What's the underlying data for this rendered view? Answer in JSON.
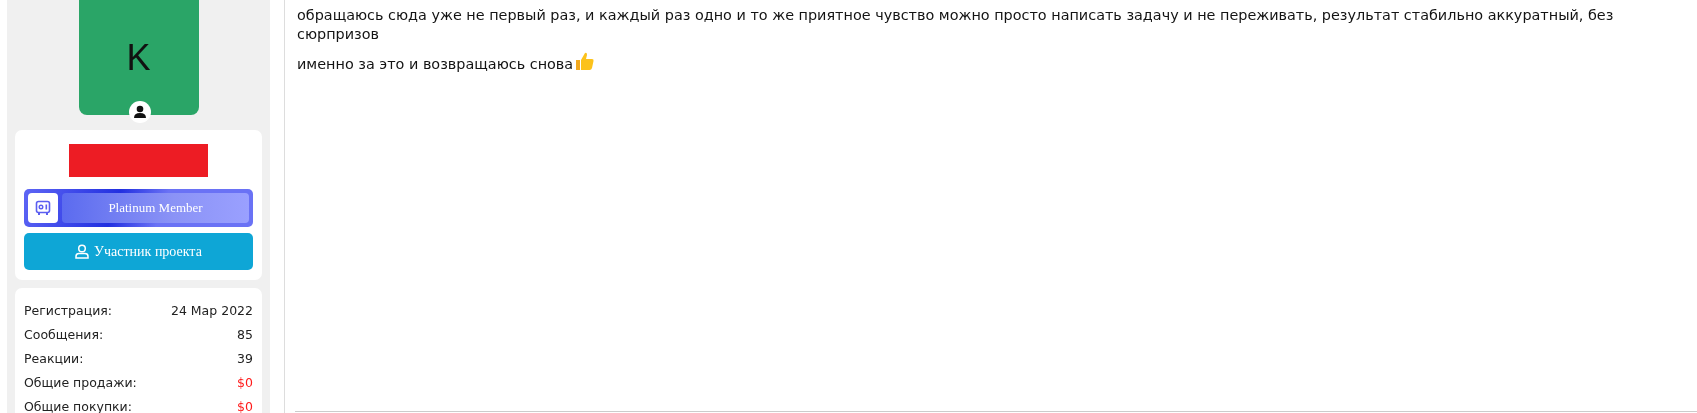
{
  "avatar": {
    "letter": "K"
  },
  "badge": {
    "label": "Platinum Member"
  },
  "role_button": {
    "label": "Участник проекта"
  },
  "stats": [
    {
      "label": "Регистрация:",
      "value": "24 Мар 2022",
      "highlight": false
    },
    {
      "label": "Сообщения:",
      "value": "85",
      "highlight": false
    },
    {
      "label": "Реакции:",
      "value": "39",
      "highlight": false
    },
    {
      "label": "Общие продажи:",
      "value": "$0",
      "highlight": true
    },
    {
      "label": "Общие покупки:",
      "value": "$0",
      "highlight": true
    }
  ],
  "message": {
    "paragraphs": [
      "обращаюсь сюда уже не первый раз, и каждый раз одно и то же приятное чувство можно просто написать задачу и не переживать, результат стабильно аккуратный, без сюрпризов",
      "именно за это и возвращаюсь снова"
    ]
  }
}
